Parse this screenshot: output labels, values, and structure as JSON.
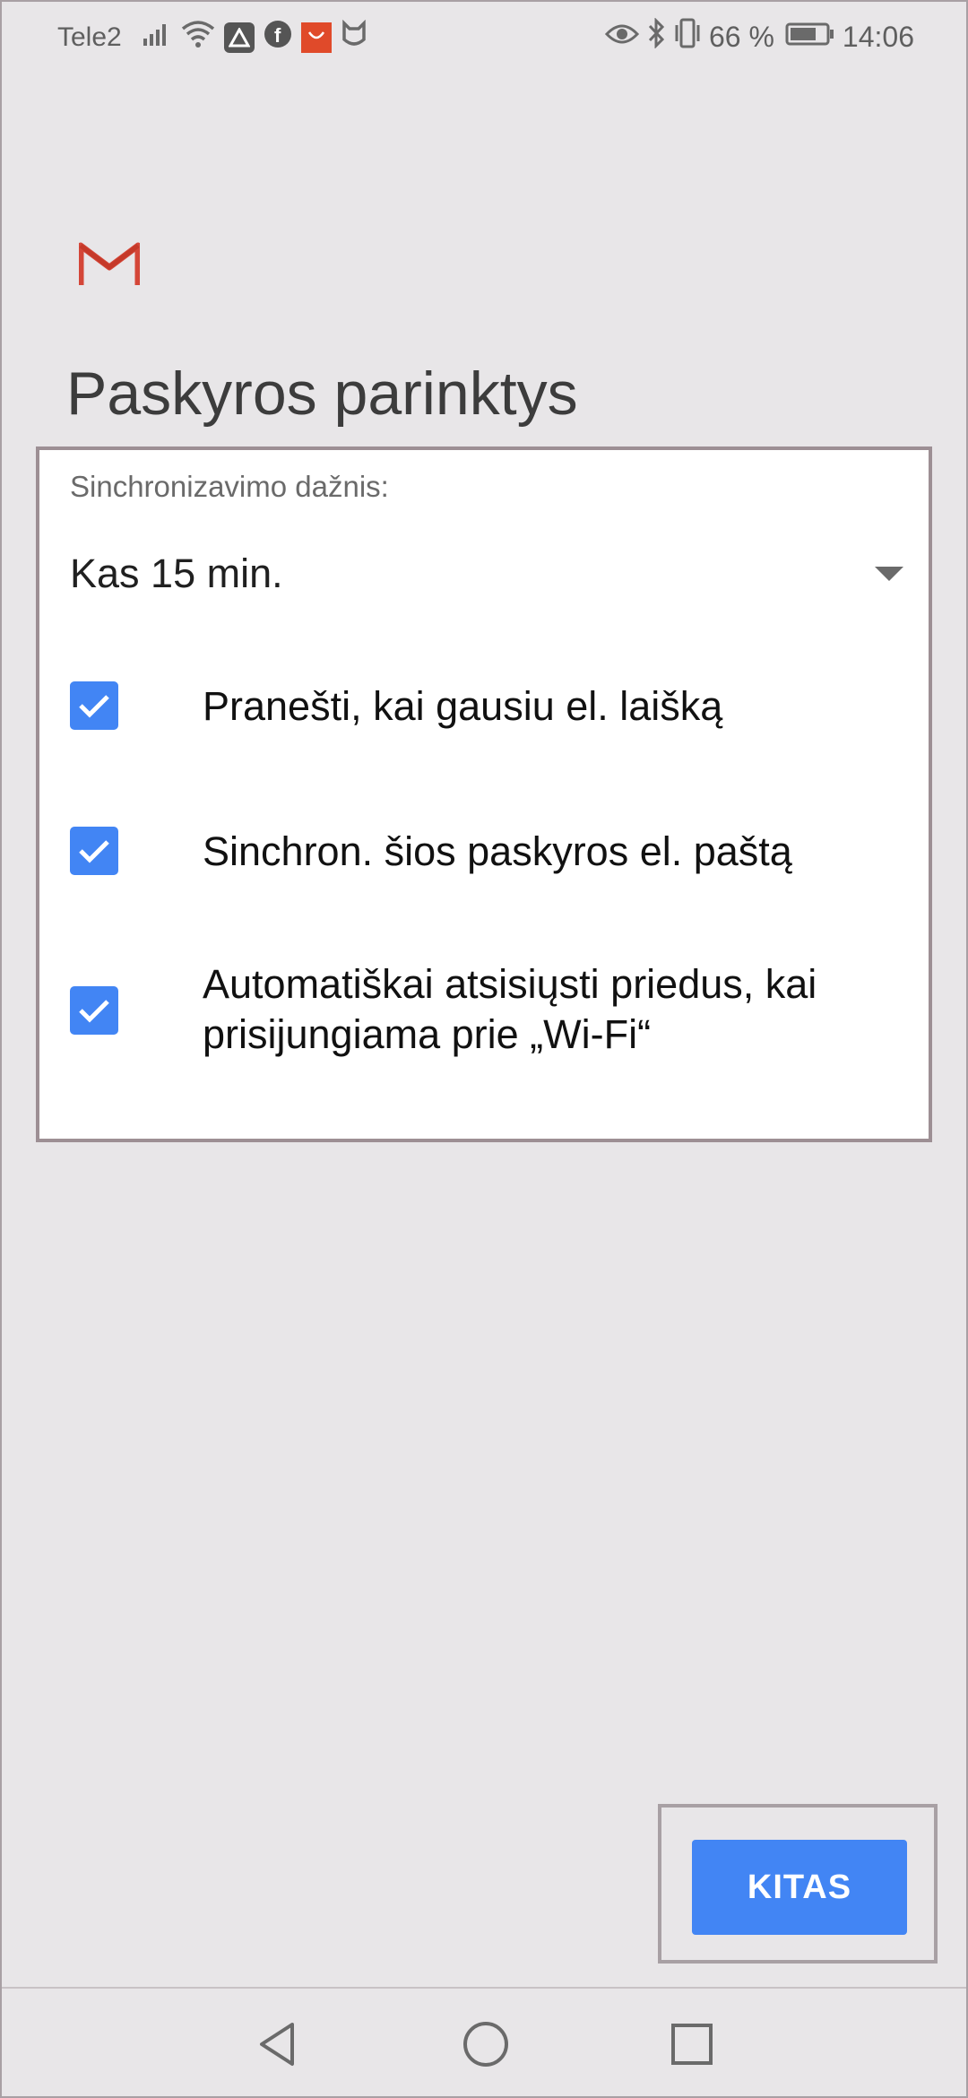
{
  "status_bar": {
    "carrier": "Tele2",
    "battery_percent": "66 %",
    "time": "14:06",
    "icons": [
      "signal-icon",
      "wifi-icon",
      "app-notification-icon",
      "facebook-icon",
      "aliexpress-icon",
      "mi-home-icon",
      "eye-icon",
      "bluetooth-icon",
      "vibrate-icon",
      "battery-icon"
    ]
  },
  "page": {
    "title": "Paskyros parinktys"
  },
  "options_card": {
    "sync_label": "Sinchronizavimo dažnis:",
    "sync_value": "Kas 15 min.",
    "options": [
      {
        "label": "Pranešti, kai gausiu el. laišką",
        "checked": true
      },
      {
        "label": "Sinchron. šios paskyros el. paštą",
        "checked": true
      },
      {
        "label": "Automatiškai atsisiųsti priedus, kai prisijungiama prie „Wi-Fi“",
        "checked": true
      }
    ]
  },
  "actions": {
    "next_label": "KITAS"
  },
  "colors": {
    "accent": "#4285f4",
    "background": "#e8e6e8",
    "gmail_red": "#d44638"
  }
}
